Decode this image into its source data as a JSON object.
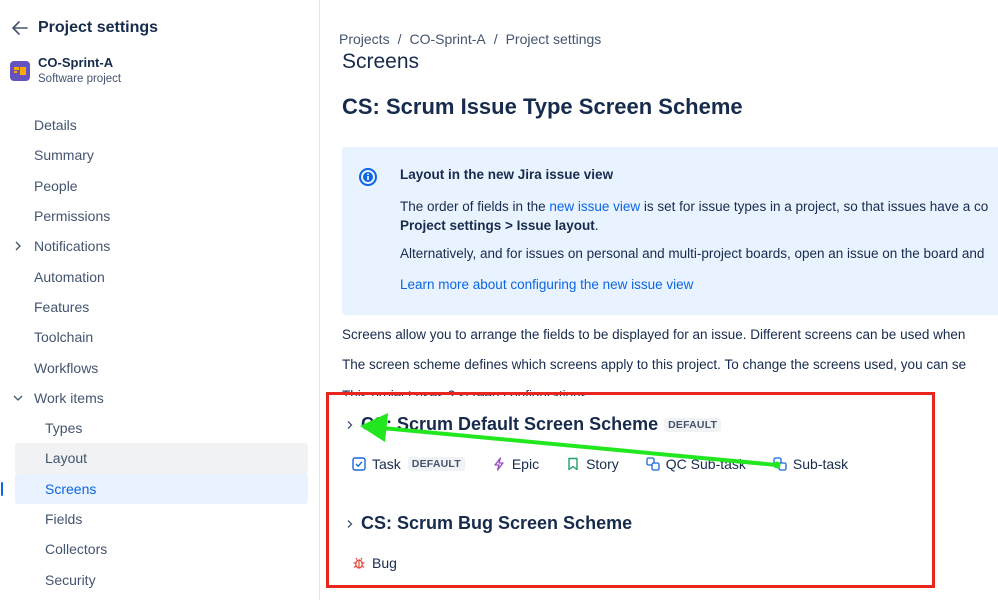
{
  "sidebar": {
    "title": "Project settings",
    "project_name": "CO-Sprint-A",
    "project_type": "Software project",
    "items": [
      {
        "label": "Details"
      },
      {
        "label": "Summary"
      },
      {
        "label": "People"
      },
      {
        "label": "Permissions"
      },
      {
        "label": "Notifications"
      },
      {
        "label": "Automation"
      },
      {
        "label": "Features"
      },
      {
        "label": "Toolchain"
      },
      {
        "label": "Workflows"
      },
      {
        "label": "Work items"
      },
      {
        "label": "Types"
      },
      {
        "label": "Layout"
      },
      {
        "label": "Screens"
      },
      {
        "label": "Fields"
      },
      {
        "label": "Collectors"
      },
      {
        "label": "Security"
      }
    ]
  },
  "breadcrumb": {
    "items": [
      "Projects",
      "CO-Sprint-A",
      "Project settings"
    ],
    "separator": "/"
  },
  "page_title": "Screens",
  "scheme_title": "CS: Scrum Issue Type Screen Scheme",
  "info": {
    "title": "Layout in the new Jira issue view",
    "p1_pre": "The order of fields in the ",
    "p1_link": "new issue view",
    "p1_post": " is set for issue types in a project, so that issues have a co",
    "p1_bold": "Project settings > Issue layout",
    "p1_end": ".",
    "p2": "Alternatively, and for issues on personal and multi-project boards, open an issue on the board and",
    "link": "Learn more about configuring the new issue view"
  },
  "paragraphs": {
    "p1": "Screens allow you to arrange the fields to be displayed for an issue. Different screens can be used when",
    "p2": "The screen scheme defines which screens apply to this project. To change the screens used, you can se",
    "p3": "This project uses 2 screen configurations."
  },
  "schemes": [
    {
      "name": "CS: Scrum Default Screen Scheme",
      "badge": "DEFAULT",
      "types": [
        {
          "label": "Task",
          "badge": "DEFAULT",
          "icon": "task-checkbox-icon"
        },
        {
          "label": "Epic",
          "icon": "epic-lightning-icon"
        },
        {
          "label": "Story",
          "icon": "story-bookmark-icon"
        },
        {
          "label": "QC Sub-task",
          "icon": "subtask-icon"
        },
        {
          "label": "Sub-task",
          "icon": "subtask-icon"
        }
      ]
    },
    {
      "name": "CS: Scrum Bug Screen Scheme",
      "types": [
        {
          "label": "Bug",
          "icon": "bug-icon"
        }
      ]
    }
  ],
  "colors": {
    "accent": "#0c66e4",
    "annotation_box": "#e8251e",
    "annotation_arrow": "#22e61e",
    "info_bg": "#e9f2ff"
  }
}
